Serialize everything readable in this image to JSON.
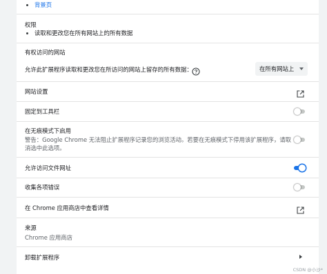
{
  "background_page": {
    "link": "背景页"
  },
  "permissions": {
    "title": "权限",
    "items": [
      "读取和更改您在所有网站上的所有数据"
    ]
  },
  "site_access": {
    "section_title": "有权访问的网站",
    "question": "允许此扩展程序读取和更改您在所访问的网站上留存的所有数据：",
    "select_value": "在所有网站上"
  },
  "site_settings": {
    "label": "网站设置"
  },
  "pin_toolbar": {
    "label": "固定到工具栏",
    "enabled": false
  },
  "incognito": {
    "label": "在无痕模式下启用",
    "warning_line1": "警告：Google Chrome 无法阻止扩展程序记录您的浏览活动。若要在无痕模式下停用该扩展程序，请取",
    "warning_line2": "消选中此选项。",
    "enabled": false
  },
  "file_urls": {
    "label": "允许访问文件网址",
    "enabled": true
  },
  "collect_errors": {
    "label": "收集各项错误",
    "enabled": false
  },
  "webstore": {
    "label": "在 Chrome 应用商店中查看详情"
  },
  "source": {
    "title": "来源",
    "value": "Chrome 应用商店"
  },
  "uninstall": {
    "label": "卸载扩展程序"
  },
  "watermark": "CSDN @小沙*",
  "colors": {
    "accent": "#1a73e8",
    "toggle_off": "#c4c7c5"
  }
}
